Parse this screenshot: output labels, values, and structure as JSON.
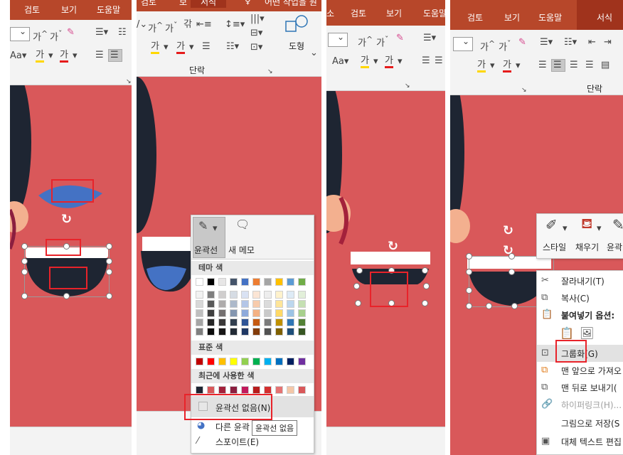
{
  "tabs": {
    "review": "검토",
    "view": "보기",
    "help": "도움말",
    "format": "서식",
    "p1_help": "도움말",
    "p2_review_partial": "검토",
    "p2_view_partial": "보",
    "p2_format": "서식",
    "p2_tell": "어떤 작업을 원"
  },
  "ribbon": {
    "font_grow": "가",
    "font_shrink": "가",
    "aa": "Aa",
    "highlight": "가",
    "font_color": "가",
    "paragraph_group": "단락",
    "shapes": "도형",
    "style": "스타일",
    "fill": "채우기",
    "outline": "윤곽선",
    "new_memo": "새 메모"
  },
  "outline_menu": {
    "header_button_label": "윤곽선",
    "new_memo": "새 메모",
    "theme_colors": "테마 색",
    "standard_colors": "표준 색",
    "recent_colors": "최근에 사용한 색",
    "no_outline": "윤곽선 없음(N)",
    "more_colors": "다른 윤곽",
    "eyedropper": "스포이트(E)",
    "tooltip": "윤곽선 없음",
    "theme_top": [
      "#ffffff",
      "#000000",
      "#e7e6e6",
      "#44546a",
      "#4472c4",
      "#ed7d31",
      "#a5a5a5",
      "#ffc000",
      "#5b9bd5",
      "#70ad47"
    ],
    "theme_shades": [
      [
        "#f2f2f2",
        "#7f7f7f",
        "#d0cece",
        "#d6dce4",
        "#d9e2f3",
        "#fbe5d5",
        "#ededed",
        "#fff2cc",
        "#deebf6",
        "#e2efd9"
      ],
      [
        "#d8d8d8",
        "#595959",
        "#aeabab",
        "#adb9ca",
        "#b4c6e7",
        "#f7cbac",
        "#dbdbdb",
        "#fee599",
        "#bdd7ee",
        "#c5e0b3"
      ],
      [
        "#bfbfbf",
        "#3f3f3f",
        "#757070",
        "#8496b0",
        "#8eaadb",
        "#f4b183",
        "#c9c9c9",
        "#ffd965",
        "#9cc3e5",
        "#a8d08d"
      ],
      [
        "#a5a5a5",
        "#262626",
        "#3a3838",
        "#323f4f",
        "#2f5496",
        "#c55a11",
        "#7b7b7b",
        "#bf9000",
        "#2e75b5",
        "#538135"
      ],
      [
        "#7f7f7f",
        "#0c0c0c",
        "#171616",
        "#222a35",
        "#1f3864",
        "#833c0b",
        "#525252",
        "#7f6000",
        "#1e4e79",
        "#375623"
      ]
    ],
    "standard": [
      "#c00000",
      "#ff0000",
      "#ffc000",
      "#ffff00",
      "#92d050",
      "#00b050",
      "#00b0f0",
      "#0070c0",
      "#002060",
      "#7030a0"
    ],
    "recent": [
      "#1e2532",
      "#d9585a",
      "#a3213b",
      "#8b1e3f",
      "#c2185b",
      "#b71c1c",
      "#d32f2f",
      "#e57373",
      "#f4c7a8",
      "#d9585a"
    ]
  },
  "context_menu": {
    "style": "스타일",
    "fill": "채우기",
    "outline": "윤곽",
    "cut": "잘라내기(T)",
    "copy": "복사(C)",
    "paste_options": "붙여넣기 옵션:",
    "group": "그룹화(G)",
    "bring_front": "맨 앞으로 가져오",
    "send_back": "맨 뒤로 보내기(",
    "hyperlink": "하이퍼링크(H)...",
    "save_as_picture": "그림으로 저장(S",
    "alt_text": "대체 텍스트 편집"
  },
  "colors": {
    "tabbar": "#b7472a",
    "slide_bg": "#d9585a",
    "hair": "#1e2532",
    "skin": "#f3b08f",
    "mouth_blue": "#4472c4",
    "highlight_red": "#e8232a"
  }
}
